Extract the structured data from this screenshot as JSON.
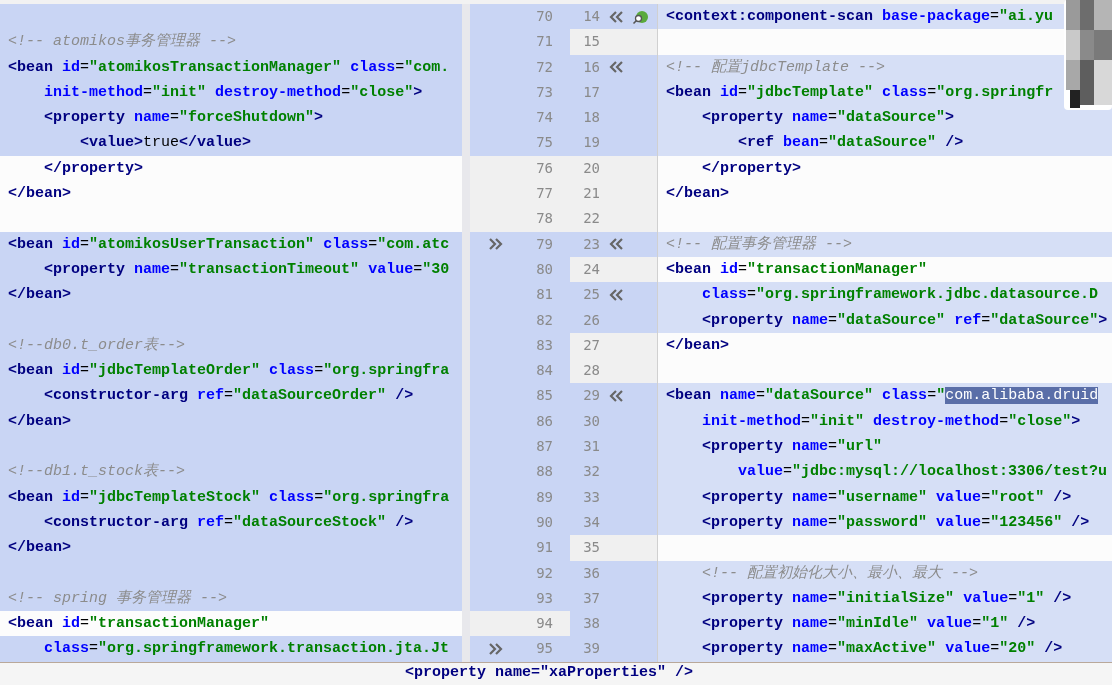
{
  "rows": [
    {
      "left_number": "70",
      "left_text": "",
      "left_changed": true,
      "left_apply": false,
      "right_number": "14",
      "right_text": "<context:component-scan base-package=\"ai.yu",
      "right_changed": true,
      "right_apply": true,
      "right_icon": true
    },
    {
      "left_number": "71",
      "left_text": "<!-- atomikos事务管理器 -->",
      "left_changed": true,
      "left_apply": false,
      "right_number": "15",
      "right_text": "",
      "right_changed": false,
      "right_apply": false,
      "right_icon": false
    },
    {
      "left_number": "72",
      "left_text": "<bean id=\"atomikosTransactionManager\" class=\"com.",
      "left_changed": true,
      "left_apply": false,
      "right_number": "16",
      "right_text": "<!-- 配置jdbcTemplate -->",
      "right_changed": true,
      "right_apply": true,
      "right_icon": false
    },
    {
      "left_number": "73",
      "left_text": "    init-method=\"init\" destroy-method=\"close\">",
      "left_changed": true,
      "left_apply": false,
      "right_number": "17",
      "right_text": "<bean id=\"jdbcTemplate\" class=\"org.springfr",
      "right_changed": true,
      "right_apply": false,
      "right_icon": false
    },
    {
      "left_number": "74",
      "left_text": "    <property name=\"forceShutdown\">",
      "left_changed": true,
      "left_apply": false,
      "right_number": "18",
      "right_text": "    <property name=\"dataSource\">",
      "right_changed": true,
      "right_apply": false,
      "right_icon": false
    },
    {
      "left_number": "75",
      "left_text": "        <value>true</value>",
      "left_changed": true,
      "left_apply": false,
      "right_number": "19",
      "right_text": "        <ref bean=\"dataSource\" />",
      "right_changed": true,
      "right_apply": false,
      "right_icon": false
    },
    {
      "left_number": "76",
      "left_text": "    </property>",
      "left_changed": false,
      "left_apply": false,
      "right_number": "20",
      "right_text": "    </property>",
      "right_changed": false,
      "right_apply": false,
      "right_icon": false
    },
    {
      "left_number": "77",
      "left_text": "</bean>",
      "left_changed": false,
      "left_apply": false,
      "right_number": "21",
      "right_text": "</bean>",
      "right_changed": false,
      "right_apply": false,
      "right_icon": false
    },
    {
      "left_number": "78",
      "left_text": "",
      "left_changed": false,
      "left_apply": false,
      "right_number": "22",
      "right_text": "",
      "right_changed": false,
      "right_apply": false,
      "right_icon": false
    },
    {
      "left_number": "79",
      "left_text": "<bean id=\"atomikosUserTransaction\" class=\"com.atc",
      "left_changed": true,
      "left_apply": true,
      "right_number": "23",
      "right_text": "<!-- 配置事务管理器 -->",
      "right_changed": true,
      "right_apply": true,
      "right_icon": false
    },
    {
      "left_number": "80",
      "left_text": "    <property name=\"transactionTimeout\" value=\"30",
      "left_changed": true,
      "left_apply": false,
      "right_number": "24",
      "right_text": "<bean id=\"transactionManager\"",
      "right_changed": false,
      "right_apply": false,
      "right_icon": false
    },
    {
      "left_number": "81",
      "left_text": "</bean>",
      "left_changed": true,
      "left_apply": false,
      "right_number": "25",
      "right_text": "    class=\"org.springframework.jdbc.datasource.D",
      "right_changed": true,
      "right_apply": true,
      "right_icon": false
    },
    {
      "left_number": "82",
      "left_text": "",
      "left_changed": true,
      "left_apply": false,
      "right_number": "26",
      "right_text": "    <property name=\"dataSource\" ref=\"dataSource\">",
      "right_changed": true,
      "right_apply": false,
      "right_icon": false
    },
    {
      "left_number": "83",
      "left_text": "<!--db0.t_order表-->",
      "left_changed": true,
      "left_apply": false,
      "right_number": "27",
      "right_text": "</bean>",
      "right_changed": false,
      "right_apply": false,
      "right_icon": false
    },
    {
      "left_number": "84",
      "left_text": "<bean id=\"jdbcTemplateOrder\" class=\"org.springfra",
      "left_changed": true,
      "left_apply": false,
      "right_number": "28",
      "right_text": "",
      "right_changed": false,
      "right_apply": false,
      "right_icon": false
    },
    {
      "left_number": "85",
      "left_text": "    <constructor-arg ref=\"dataSourceOrder\" />",
      "left_changed": true,
      "left_apply": false,
      "right_number": "29",
      "right_text": "<bean name=\"dataSource\" class=\"",
      "right_selection": "com.alibaba.druid",
      "right_changed": true,
      "right_apply": true,
      "right_icon": false
    },
    {
      "left_number": "86",
      "left_text": "</bean>",
      "left_changed": true,
      "left_apply": false,
      "right_number": "30",
      "right_text": "    init-method=\"init\" destroy-method=\"close\">",
      "right_changed": true,
      "right_apply": false,
      "right_icon": false
    },
    {
      "left_number": "87",
      "left_text": "",
      "left_changed": true,
      "left_apply": false,
      "right_number": "31",
      "right_text": "    <property name=\"url\"",
      "right_changed": true,
      "right_apply": false,
      "right_icon": false
    },
    {
      "left_number": "88",
      "left_text": "<!--db1.t_stock表-->",
      "left_changed": true,
      "left_apply": false,
      "right_number": "32",
      "right_text": "        value=\"jdbc:mysql://localhost:3306/test?u",
      "right_changed": true,
      "right_apply": false,
      "right_icon": false
    },
    {
      "left_number": "89",
      "left_text": "<bean id=\"jdbcTemplateStock\" class=\"org.springfra",
      "left_changed": true,
      "left_apply": false,
      "right_number": "33",
      "right_text": "    <property name=\"username\" value=\"root\" />",
      "right_changed": true,
      "right_apply": false,
      "right_icon": false
    },
    {
      "left_number": "90",
      "left_text": "    <constructor-arg ref=\"dataSourceStock\" />",
      "left_changed": true,
      "left_apply": false,
      "right_number": "34",
      "right_text": "    <property name=\"password\" value=\"123456\" />",
      "right_changed": true,
      "right_apply": false,
      "right_icon": false
    },
    {
      "left_number": "91",
      "left_text": "</bean>",
      "left_changed": true,
      "left_apply": false,
      "right_number": "35",
      "right_text": "",
      "right_changed": false,
      "right_apply": false,
      "right_icon": false
    },
    {
      "left_number": "92",
      "left_text": "",
      "left_changed": true,
      "left_apply": false,
      "right_number": "36",
      "right_text": "    <!-- 配置初始化大小、最小、最大 -->",
      "right_changed": true,
      "right_apply": false,
      "right_icon": false
    },
    {
      "left_number": "93",
      "left_text": "<!-- spring 事务管理器 -->",
      "left_changed": true,
      "left_apply": false,
      "right_number": "37",
      "right_text": "    <property name=\"initialSize\" value=\"1\" />",
      "right_changed": true,
      "right_apply": false,
      "right_icon": false
    },
    {
      "left_number": "94",
      "left_text": "<bean id=\"transactionManager\"",
      "left_changed": false,
      "left_apply": false,
      "right_number": "38",
      "right_text": "    <property name=\"minIdle\" value=\"1\" />",
      "right_changed": true,
      "right_apply": false,
      "right_icon": false
    },
    {
      "left_number": "95",
      "left_text": "    class=\"org.springframework.transaction.jta.Jt",
      "left_changed": true,
      "left_apply": true,
      "right_number": "39",
      "right_text": "    <property name=\"maxActive\" value=\"20\" />",
      "right_changed": true,
      "right_apply": false,
      "right_icon": false
    }
  ],
  "background_window": {
    "text": "<property name=\"xaProperties\" />"
  }
}
